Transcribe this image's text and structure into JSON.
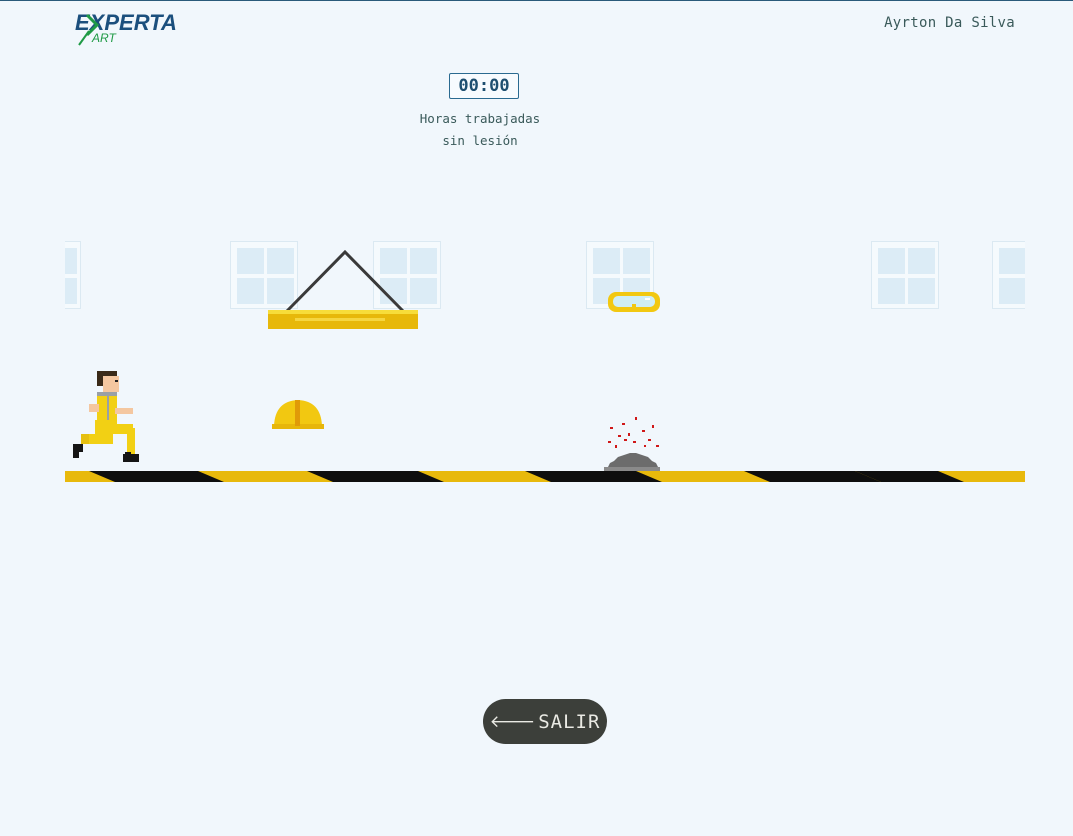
{
  "brand": {
    "name": "EXPERTA",
    "sub": "ART",
    "color_green": "#1f9a45",
    "color_blue": "#1b4f7d"
  },
  "user": {
    "name": "Ayrton Da Silva"
  },
  "timer": {
    "value": "00:00",
    "caption_line1": "Horas trabajadas",
    "caption_line2": "sin lesión"
  },
  "game": {
    "player": "worker-running",
    "items": [
      "hard-hat",
      "safety-goggles",
      "suspended-beam",
      "circular-saw"
    ],
    "colors": {
      "ground_yellow": "#e8b90c",
      "ground_black": "#0e0e0e",
      "item_yellow": "#f2cc18"
    }
  },
  "exit_button": {
    "label": "SALIR",
    "icon": "arrow-left-icon"
  }
}
